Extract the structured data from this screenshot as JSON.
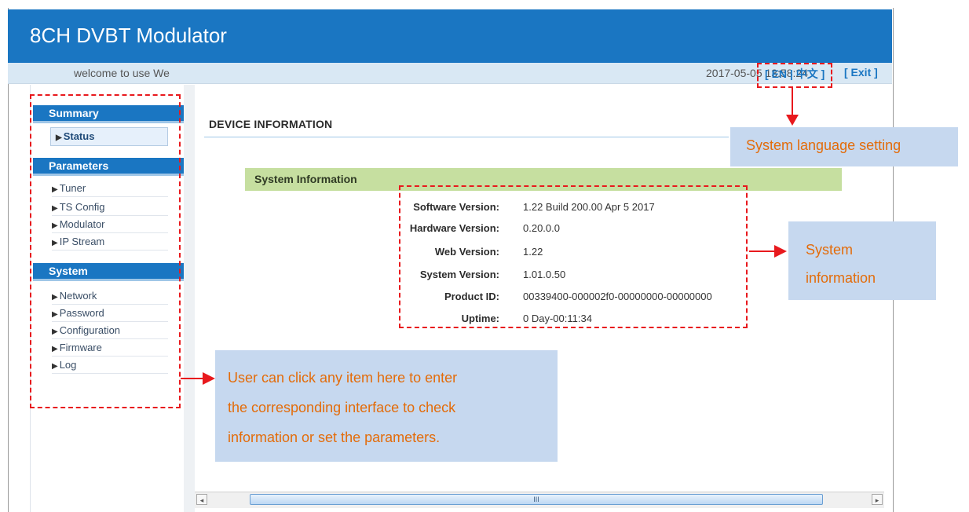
{
  "header": {
    "title": "8CH DVBT Modulator"
  },
  "topbar": {
    "welcome": "welcome to use We",
    "datetime": "2017-05-05 13:58:24",
    "lang_open": "[ ",
    "lang_en": "EN",
    "lang_sep": " | ",
    "lang_zh": "中文",
    "lang_close": " ]",
    "exit": "[ Exit ]"
  },
  "sidebar": {
    "sections": [
      {
        "title": "Summary",
        "items": [
          "Status"
        ]
      },
      {
        "title": "Parameters",
        "items": [
          "Tuner",
          "TS Config",
          "Modulator",
          "IP Stream"
        ]
      },
      {
        "title": "System",
        "items": [
          "Network",
          "Password",
          "Configuration",
          "Firmware",
          "Log"
        ]
      }
    ]
  },
  "main": {
    "title": "DEVICE INFORMATION",
    "section_title": "System Information",
    "rows": [
      {
        "label": "Software Version:",
        "value": "1.22 Build 200.00 Apr 5 2017"
      },
      {
        "label": "Hardware Version:",
        "value": "0.20.0.0"
      },
      {
        "label": "Web Version:",
        "value": "1.22"
      },
      {
        "label": "System Version:",
        "value": "1.01.0.50"
      },
      {
        "label": "Product ID:",
        "value": "00339400-000002f0-00000000-00000000"
      },
      {
        "label": "Uptime:",
        "value": "0 Day-00:11:34"
      }
    ]
  },
  "annotations": {
    "language": "System language setting",
    "sysinfo_line1": "System",
    "sysinfo_line2": "information",
    "nav_line1": "User can click any item here to enter",
    "nav_line2": "the corresponding interface to check",
    "nav_line3": "information or set the parameters."
  },
  "scrollbar": {
    "left_arrow": "◂",
    "right_arrow": "▸",
    "grip": "III"
  },
  "colors": {
    "header": "#1a76c2",
    "accent_red": "#e8191d",
    "callout_bg": "#c6d8ef",
    "callout_text": "#e36c0a",
    "section_green": "#c6dfa0"
  }
}
